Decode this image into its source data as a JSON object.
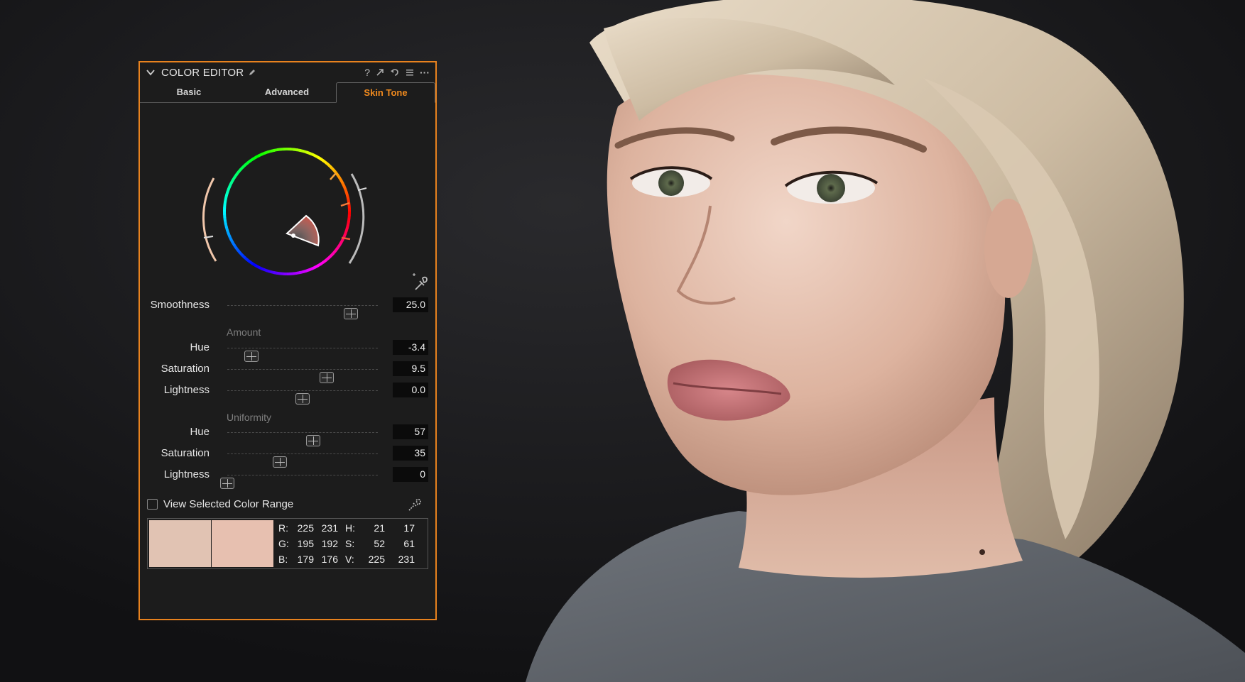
{
  "panel": {
    "title": "COLOR EDITOR",
    "accent_color": "#e8821e",
    "tools": [
      "help-icon",
      "expand-icon",
      "reset-icon",
      "menu-icon",
      "more-icon"
    ],
    "help_glyph": "?",
    "more_glyph": "···"
  },
  "tabs": [
    {
      "label": "Basic",
      "active": false
    },
    {
      "label": "Advanced",
      "active": false
    },
    {
      "label": "Skin Tone",
      "active": true
    }
  ],
  "smoothness": {
    "label": "Smoothness",
    "value": "25.0",
    "fraction": 0.82
  },
  "amount": {
    "section_label": "Amount",
    "hue": {
      "label": "Hue",
      "value": "-3.4",
      "fraction": 0.16
    },
    "saturation": {
      "label": "Saturation",
      "value": "9.5",
      "fraction": 0.66
    },
    "lightness": {
      "label": "Lightness",
      "value": "0.0",
      "fraction": 0.5
    }
  },
  "uniformity": {
    "section_label": "Uniformity",
    "hue": {
      "label": "Hue",
      "value": "57",
      "fraction": 0.57
    },
    "saturation": {
      "label": "Saturation",
      "value": "35",
      "fraction": 0.35
    },
    "lightness": {
      "label": "Lightness",
      "value": "0",
      "fraction": 0.0
    }
  },
  "view_range": {
    "label": "View Selected Color Range",
    "checked": false
  },
  "swatches": {
    "left": "#e1c3b3",
    "right": "#e7c0b0"
  },
  "color_stats": {
    "r_label": "R:",
    "r1": "225",
    "r2": "231",
    "g_label": "G:",
    "g1": "195",
    "g2": "192",
    "b_label": "B:",
    "b1": "179",
    "b2": "176",
    "h_label": "H:",
    "h1": "21",
    "h2": "17",
    "s_label": "S:",
    "s1": "52",
    "s2": "61",
    "v_label": "V:",
    "v1": "225",
    "v2": "231"
  }
}
